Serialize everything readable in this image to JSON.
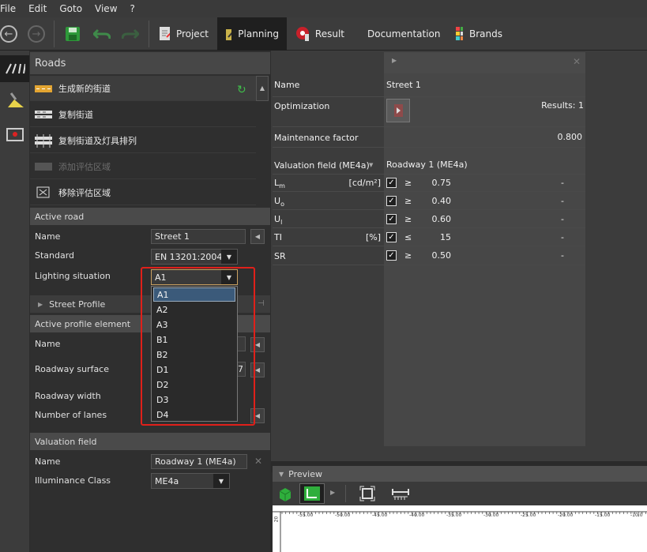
{
  "menu": {
    "items": [
      "File",
      "Edit",
      "Goto",
      "View",
      "?"
    ]
  },
  "toolbar": {
    "tabs": [
      {
        "label": "Project"
      },
      {
        "label": "Planning"
      },
      {
        "label": "Result"
      },
      {
        "label": "Documentation"
      },
      {
        "label": "Brands"
      }
    ]
  },
  "roads": {
    "title": "Roads",
    "actions": [
      {
        "label": "生成新的街道"
      },
      {
        "label": "复制街道"
      },
      {
        "label": "复制街道及灯具排列"
      },
      {
        "label": "添加评估区域"
      },
      {
        "label": "移除评估区域"
      }
    ]
  },
  "active_road": {
    "title": "Active road",
    "name_label": "Name",
    "name_value": "Street 1",
    "standard_label": "Standard",
    "standard_value": "EN 13201:2004",
    "lighting_label": "Lighting situation",
    "lighting_value": "A1"
  },
  "street_profile": {
    "title": "Street Profile"
  },
  "profile_element": {
    "title": "Active profile element",
    "name_label": "Name",
    "surface_label": "Roadway surface",
    "surface_value_tail": "7",
    "width_label": "Roadway width",
    "lanes_label": "Number of lanes"
  },
  "valuation_field": {
    "title": "Valuation field",
    "name_label": "Name",
    "name_value": "Roadway 1 (ME4a)",
    "class_label": "Illuminance Class",
    "class_value": "ME4a"
  },
  "dropdown": {
    "options": [
      "A1",
      "A2",
      "A3",
      "B1",
      "B2",
      "D1",
      "D2",
      "D3",
      "D4"
    ],
    "selected": "A1"
  },
  "properties": {
    "name_label": "Name",
    "name_value": "Street 1",
    "optimization_label": "Optimization",
    "results_text": "Results:  1",
    "maintenance_label": "Maintenance factor",
    "maintenance_value": "0.800",
    "valuation_label": "Valuation field (ME4a)",
    "valuation_value": "Roadway 1 (ME4a)",
    "rows": [
      {
        "label": "Lm",
        "unit": "[cd/m²]",
        "op": "≥",
        "value": "0.75",
        "result": "-"
      },
      {
        "label": "Uo",
        "unit": "",
        "op": "≥",
        "value": "0.40",
        "result": "-"
      },
      {
        "label": "Ul",
        "unit": "",
        "op": "≥",
        "value": "0.60",
        "result": "-"
      },
      {
        "label": "TI",
        "unit": "[%]",
        "op": "≤",
        "value": "15",
        "result": "-"
      },
      {
        "label": "SR",
        "unit": "",
        "op": "≥",
        "value": "0.50",
        "result": "-"
      }
    ]
  },
  "preview": {
    "title": "Preview",
    "ruler_labels": [
      "-55.00",
      "-50.00",
      "-45.00",
      "-40.00",
      "-35.00",
      "-30.00",
      "-25.00",
      "-20.00",
      "-15.00",
      "-10.0"
    ],
    "vertical_label": "20"
  },
  "colors": {
    "accent_red": "#e0201a",
    "selection_blue": "#3b5a7a",
    "active_tab": "#1f1f1f"
  }
}
